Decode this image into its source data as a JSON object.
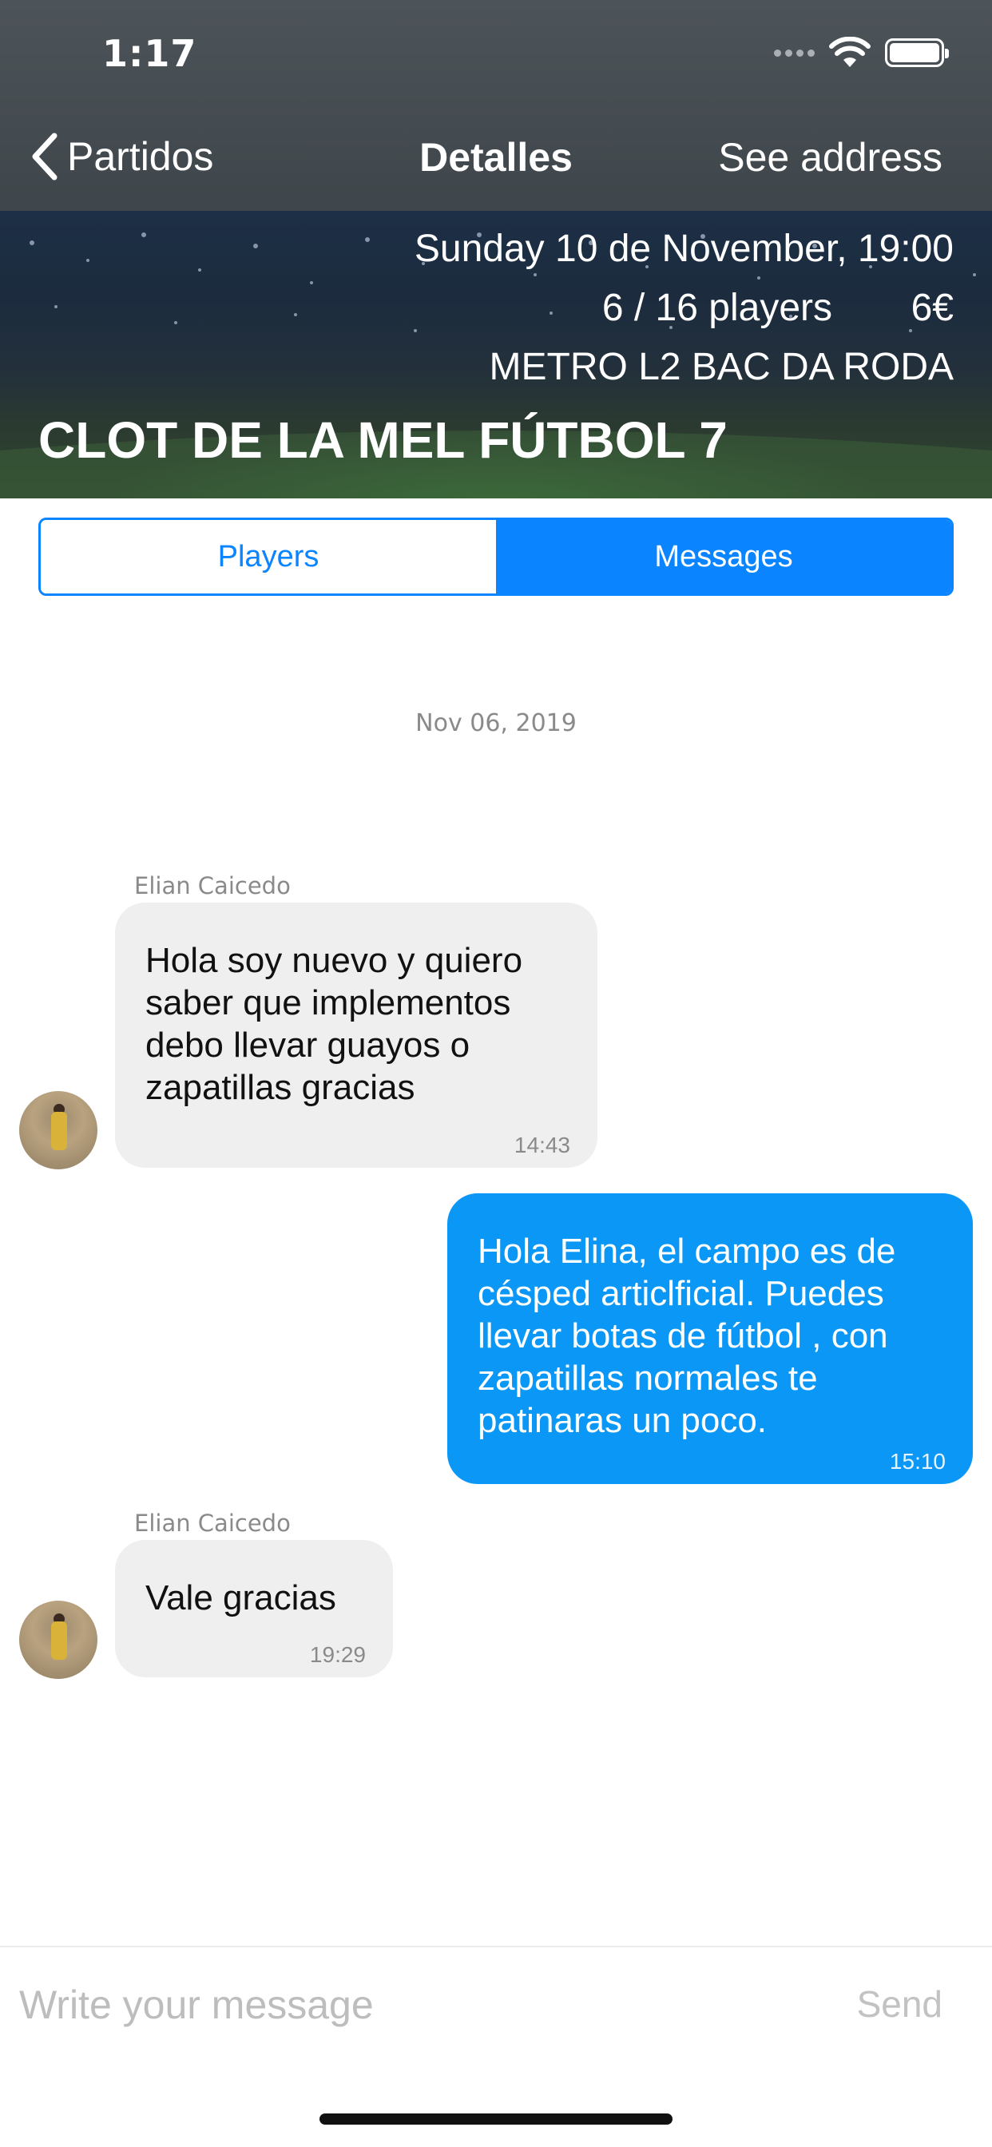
{
  "status_bar": {
    "time": "1:17"
  },
  "nav": {
    "back_label": "Partidos",
    "title": "Detalles",
    "action_label": "See address"
  },
  "banner": {
    "datetime": "Sunday 10 de November, 19:00",
    "players": "6 / 16 players",
    "price": "6€",
    "location": "METRO L2 BAC DA RODA",
    "title": "CLOT DE LA MEL FÚTBOL 7"
  },
  "tabs": [
    {
      "label": "Players",
      "active": false
    },
    {
      "label": "Messages",
      "active": true
    }
  ],
  "chat": {
    "date_separator": "Nov 06, 2019",
    "messages": [
      {
        "sender": "Elian Caicedo",
        "direction": "incoming",
        "text": "Hola soy nuevo y quiero\nsaber que implementos\ndebo llevar guayos o\nzapatillas gracias",
        "time": "14:43"
      },
      {
        "sender": "",
        "direction": "outgoing",
        "text": "Hola Elina, el campo es de\ncésped articlficial. Puedes\nllevar botas de fútbol , con\nzapatillas normales te\npatinaras un poco.",
        "time": "15:10"
      },
      {
        "sender": "Elian Caicedo",
        "direction": "incoming",
        "text": "Vale gracias",
        "time": "19:29"
      }
    ]
  },
  "composer": {
    "placeholder": "Write your message",
    "send_label": "Send"
  },
  "colors": {
    "accent": "#0a84ff",
    "outgoing_bubble": "#0a97f5",
    "incoming_bubble": "#efefef",
    "topbar": "#454c51"
  },
  "icons": [
    "back-chevron-icon",
    "wifi-icon",
    "battery-icon",
    "cellular-signal-icon"
  ]
}
